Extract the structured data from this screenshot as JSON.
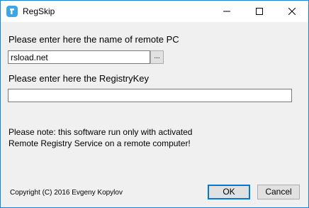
{
  "window": {
    "title": "RegSkip",
    "icon": "app-icon",
    "controls": {
      "minimize_icon": "minimize-icon",
      "maximize_icon": "maximize-icon",
      "close_icon": "close-icon"
    }
  },
  "form": {
    "remote_pc_label": "Please enter here the name of remote PC",
    "remote_pc_value": "rsload.net",
    "browse_label": "...",
    "registry_key_label": "Please enter here the RegistryKey",
    "registry_key_value": ""
  },
  "note": {
    "line1": "Please note: this software run only with activated",
    "line2": "Remote Registry Service on a remote computer!"
  },
  "footer": {
    "copyright": "Copyright (C) 2016 Evgeny Kopylov",
    "ok_label": "OK",
    "cancel_label": "Cancel"
  },
  "colors": {
    "window_border": "#1883d7",
    "accent": "#0078d7",
    "app_icon": "#3ba7e8",
    "background": "#f0f0f0"
  }
}
